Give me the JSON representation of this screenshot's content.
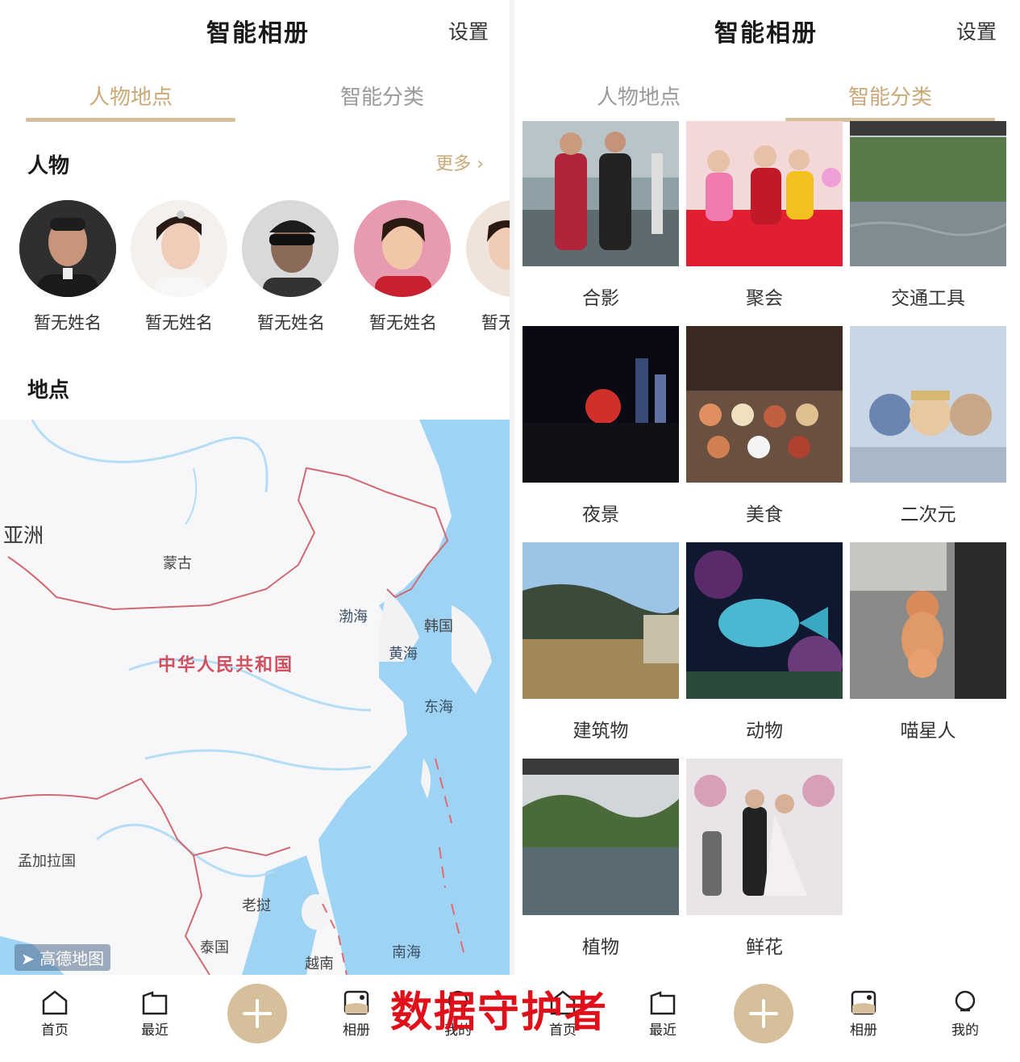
{
  "left": {
    "header": {
      "title": "智能相册",
      "settings": "设置"
    },
    "tabs": [
      {
        "label": "人物地点",
        "active": true
      },
      {
        "label": "智能分类",
        "active": false
      }
    ],
    "people_section": {
      "title": "人物",
      "more": "更多 ›"
    },
    "people": [
      {
        "name": "暂无姓名"
      },
      {
        "name": "暂无姓名"
      },
      {
        "name": "暂无姓名"
      },
      {
        "name": "暂无姓名"
      },
      {
        "name": "暂无"
      }
    ],
    "places_section": {
      "title": "地点"
    },
    "map": {
      "labels": {
        "continent": "亚洲",
        "mongolia": "蒙古",
        "china": "中华人民共和国",
        "bohai": "渤海",
        "korea": "韩国",
        "yellow_sea": "黄海",
        "east_sea": "东海",
        "bangladesh": "孟加拉国",
        "laos": "老挝",
        "thailand": "泰国",
        "vietnam": "越南",
        "south_sea": "南海"
      },
      "logo": "高德地图"
    }
  },
  "right": {
    "header": {
      "title": "智能相册",
      "settings": "设置"
    },
    "tabs": [
      {
        "label": "人物地点",
        "active": false
      },
      {
        "label": "智能分类",
        "active": true
      }
    ],
    "categories": [
      {
        "label": "合影"
      },
      {
        "label": "聚会"
      },
      {
        "label": "交通工具"
      },
      {
        "label": "夜景"
      },
      {
        "label": "美食"
      },
      {
        "label": "二次元"
      },
      {
        "label": "建筑物"
      },
      {
        "label": "动物"
      },
      {
        "label": "喵星人"
      },
      {
        "label": "植物"
      },
      {
        "label": "鲜花"
      }
    ]
  },
  "bottom_nav": {
    "left": [
      {
        "label": "首页",
        "icon": "home-icon"
      },
      {
        "label": "最近",
        "icon": "folder-icon"
      },
      {
        "label": "相册",
        "icon": "album-icon"
      },
      {
        "label": "我的",
        "icon": "profile-icon"
      }
    ],
    "right": [
      {
        "label": "首页",
        "icon": "home-icon"
      },
      {
        "label": "最近",
        "icon": "folder-icon"
      },
      {
        "label": "相册",
        "icon": "album-icon"
      },
      {
        "label": "我的",
        "icon": "profile-icon"
      }
    ]
  },
  "watermark": "数据守护者",
  "colors": {
    "accent": "#c9a978",
    "underline": "#d6bf9b",
    "map_water": "#9fd3f3",
    "border": "#d05060"
  }
}
